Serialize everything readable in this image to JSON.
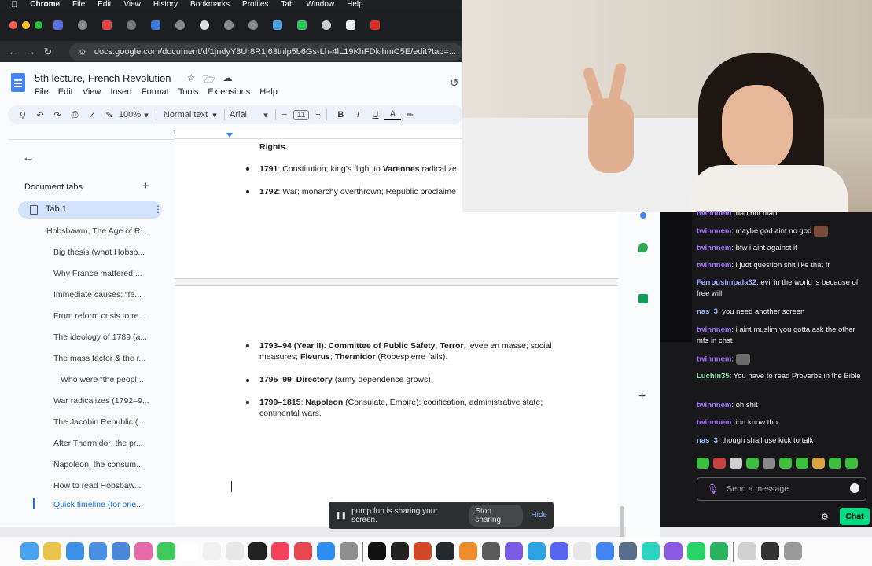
{
  "menubar": {
    "items": [
      "Chrome",
      "File",
      "Edit",
      "View",
      "History",
      "Bookmarks",
      "Profiles",
      "Tab",
      "Window",
      "Help"
    ]
  },
  "browser": {
    "url": "docs.google.com/document/d/1jndyY8Ur8R1j63tnlp5b6Gs-Lh-4lL19KhFDklhmC5E/edit?tab=..."
  },
  "docs": {
    "title": "5th lecture, French Revolution",
    "menu": [
      "File",
      "Edit",
      "View",
      "Insert",
      "Format",
      "Tools",
      "Extensions",
      "Help"
    ],
    "toolbar": {
      "zoom": "100%",
      "style": "Normal text",
      "font": "Arial",
      "size": "11",
      "minus": "−",
      "plus": "+",
      "bold": "B",
      "italic": "I",
      "underline": "U",
      "color": "A"
    },
    "ruler_mark": "1",
    "outline": {
      "section_label": "Document tabs",
      "tab_label": "Tab 1",
      "items": [
        "Hobsbawm, The Age of R...",
        "Big thesis (what Hobsb...",
        "Why France mattered ...",
        "Immediate causes: “fe...",
        "From reform crisis to re...",
        "The ideology of 1789 (a...",
        "The mass factor & the r...",
        "Who were “the peopl...",
        "War radicalizes (1792–9...",
        "The Jacobin Republic (...",
        "After Thermidor: the pr...",
        "Napoleon: the consum...",
        "How to read Hobsbaw...",
        "Quick timeline (for orie..."
      ]
    },
    "page1": {
      "rights": "Rights.",
      "b1_year": "1791",
      "b1_text1": ": Constitution; king’s flight to ",
      "b1_bold": "Varennes",
      "b1_text2": " radicalize",
      "b2_year": "1792",
      "b2_text": ": War; monarchy overthrown; Republic proclaime"
    },
    "page2": {
      "b1_line1_year": "1793–94 (Year II)",
      "b1_line1_a": ": ",
      "b1_line1_cps": "Committee of Public Safety",
      "b1_line1_b": ", ",
      "b1_line1_terror": "Terror",
      "b1_line1_c": ", levee en masse; social",
      "b1_line2_a": "measures; ",
      "b1_line2_fleurus": "Fleurus",
      "b1_line2_b": "; ",
      "b1_line2_thermidor": "Thermidor",
      "b1_line2_c": " (Robespierre falls).",
      "b2_year": "1795–99",
      "b2_a": ": ",
      "b2_directory": "Directory",
      "b2_b": " (army dependence grows).",
      "b3_year": "1799–1815",
      "b3_a": ": ",
      "b3_napoleon": "Napoleon",
      "b3_b": " (Consulate, Empire): codification, administrative state;",
      "b3_line2": "continental wars."
    }
  },
  "sharebar": {
    "text": "pump.fun is sharing your screen.",
    "stop": "Stop sharing",
    "hide": "Hide"
  },
  "chat": {
    "messages": [
      {
        "user": "twinnnem",
        "text": ": bad not mad",
        "color": "#a970ff"
      },
      {
        "user": "twinnnem",
        "text": ": maybe god aint no god",
        "color": "#a970ff"
      },
      {
        "user": "twinnnem",
        "text": ": btw i aint against it",
        "color": "#a970ff"
      },
      {
        "user": "twinnnem",
        "text": ": i judt question shit like that fr",
        "color": "#a970ff"
      },
      {
        "user": "Ferrousimpala32",
        "text": ": evil in the world is because of free will",
        "color": "#9aa7ff"
      },
      {
        "user": "nas_3",
        "text": ": you need another screen",
        "color": "#8fb7ff"
      },
      {
        "user": "twinnnem",
        "text": ": i aint muslim you gotta ask the other mfs in chst",
        "color": "#a970ff"
      },
      {
        "user": "twinnnem",
        "text": ":",
        "color": "#a970ff"
      },
      {
        "user": "Luchin35",
        "text": ": You have to read Proverbs in the Bible",
        "color": "#7ee29a"
      },
      {
        "user": "twinnnem",
        "text": ": oh shit",
        "color": "#a970ff"
      },
      {
        "user": "twinnnem",
        "text": ": ion know tho",
        "color": "#a970ff"
      },
      {
        "user": "nas_3",
        "text": ": though shall use kick to talk",
        "color": "#8fb7ff"
      }
    ],
    "input_placeholder": "Send a message",
    "send_label": "Chat"
  }
}
